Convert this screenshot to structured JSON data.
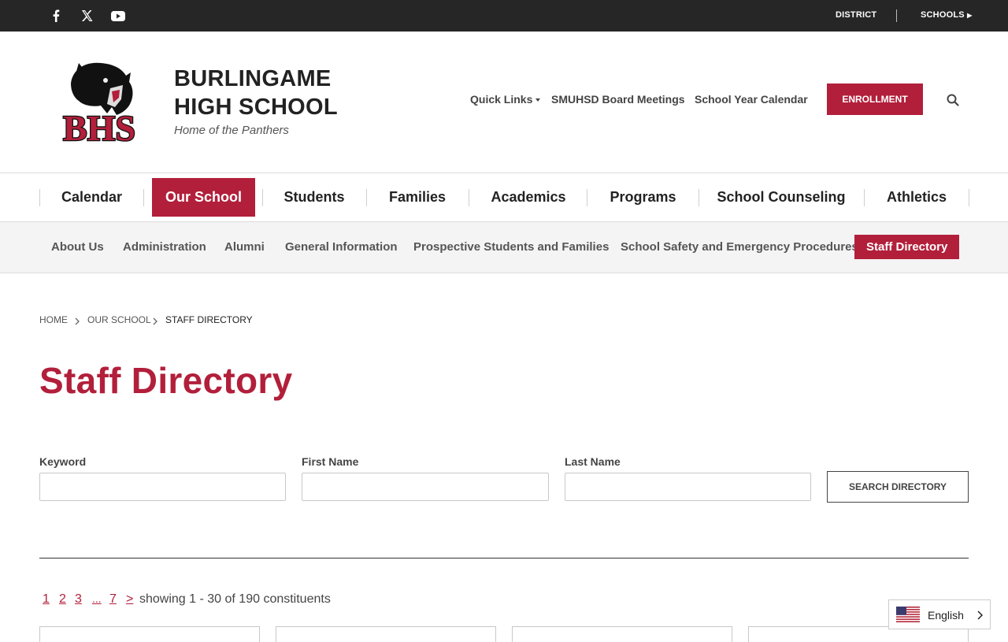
{
  "topbar": {
    "social": [
      {
        "name": "facebook-icon",
        "glyph": "f"
      },
      {
        "name": "x-twitter-icon",
        "glyph": "𝕏"
      },
      {
        "name": "youtube-icon",
        "glyph": "▶"
      }
    ],
    "district_label": "DISTRICT",
    "schools_label": "SCHOOLS"
  },
  "header": {
    "school_name_line1": "BURLINGAME",
    "school_name_line2": "HIGH SCHOOL",
    "tagline": "Home of the Panthers",
    "logo_text": "BHS",
    "quick_links_label": "Quick Links",
    "board_meetings_label": "SMUHSD Board Meetings",
    "calendar_label": "School Year Calendar",
    "enrollment_label": "ENROLLMENT"
  },
  "main_nav": {
    "items": [
      {
        "label": "Calendar"
      },
      {
        "label": "Our School"
      },
      {
        "label": "Students"
      },
      {
        "label": "Families"
      },
      {
        "label": "Academics"
      },
      {
        "label": "Programs"
      },
      {
        "label": "School Counseling"
      },
      {
        "label": "Athletics"
      }
    ]
  },
  "sub_nav": {
    "items": [
      {
        "label": "About Us"
      },
      {
        "label": "Administration"
      },
      {
        "label": "Alumni"
      },
      {
        "label": "General Information"
      },
      {
        "label": "Prospective Students and Families"
      },
      {
        "label": "School Safety and Emergency Procedures"
      },
      {
        "label": "Staff Directory"
      }
    ]
  },
  "breadcrumb": {
    "items": [
      {
        "label": "HOME"
      },
      {
        "label": "OUR SCHOOL"
      },
      {
        "label": "STAFF DIRECTORY"
      }
    ]
  },
  "page": {
    "title": "Staff Directory"
  },
  "search_form": {
    "keyword_label": "Keyword",
    "keyword_value": "",
    "first_name_label": "First Name",
    "first_name_value": "",
    "last_name_label": "Last Name",
    "last_name_value": "",
    "submit_label": "SEARCH DIRECTORY"
  },
  "pagination": {
    "pages": [
      "1",
      "2",
      "3",
      "...",
      "7",
      ">"
    ],
    "showing_text": "showing 1 - 30 of 190 constituents"
  },
  "language": {
    "selected": "English"
  },
  "colors": {
    "accent": "#b21f3b",
    "topbar": "#262626",
    "subnav_bg": "#f4f4f4"
  }
}
